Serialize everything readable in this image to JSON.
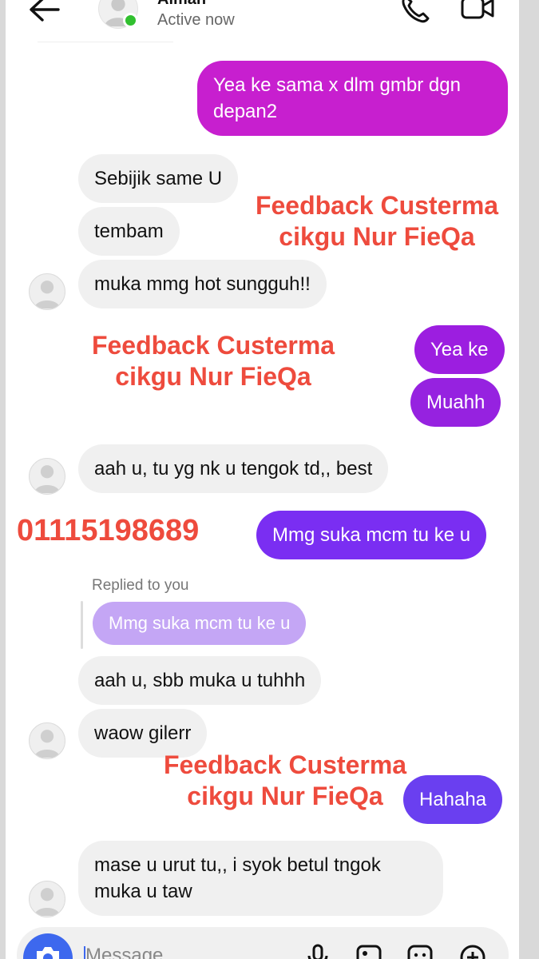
{
  "header": {
    "contact_name": "Aiman",
    "status": "Active now"
  },
  "messages": [
    {
      "id": "m1",
      "direction": "outgoing",
      "lines": [
        "Yea ke sama x dlm gmbr dgn",
        "depan2"
      ],
      "color": "#c71fcf"
    },
    {
      "id": "m2",
      "direction": "incoming",
      "text": "Sebijik same U"
    },
    {
      "id": "m3",
      "direction": "incoming",
      "text": "tembam"
    },
    {
      "id": "m4",
      "direction": "incoming",
      "text": "muka mmg hot sungguh!!"
    },
    {
      "id": "m5",
      "direction": "outgoing",
      "text": "Yea ke",
      "color": "#9c1ee0"
    },
    {
      "id": "m6",
      "direction": "outgoing",
      "text": "Muahh",
      "color": "#9622e0"
    },
    {
      "id": "m7",
      "direction": "incoming",
      "text": "aah u, tu yg nk u tengok td,, best"
    },
    {
      "id": "m8",
      "direction": "outgoing",
      "text": "Mmg suka mcm tu ke u",
      "color": "#7a2ef2"
    },
    {
      "id": "m9",
      "direction": "incoming",
      "text": "aah u, sbb muka u tuhhh"
    },
    {
      "id": "m10",
      "direction": "incoming",
      "text": "waow gilerr"
    },
    {
      "id": "m11",
      "direction": "outgoing",
      "text": "Hahaha",
      "color": "#6a3ff0"
    },
    {
      "id": "m12",
      "direction": "incoming",
      "lines": [
        "mase u urut tu,, i syok betul tngok",
        "muka u taw"
      ]
    }
  ],
  "reply": {
    "label": "Replied to you",
    "quoted_text": "Mmg suka mcm tu ke u"
  },
  "overlays": {
    "watermark_lines": [
      "Feedback Custerma",
      "cikgu Nur FieQa"
    ],
    "phone_number": "01115198689"
  },
  "composer": {
    "placeholder": "Message",
    "icons": [
      "camera-icon",
      "microphone-icon",
      "gallery-icon",
      "sticker-icon",
      "plus-icon"
    ]
  },
  "colors": {
    "accent_blue": "#3d68ee",
    "online_green": "#31c02f",
    "overlay_red": "#ee4b3d",
    "incoming_bubble": "#f0f0f0",
    "reply_bubble": "#c4a6f5"
  }
}
